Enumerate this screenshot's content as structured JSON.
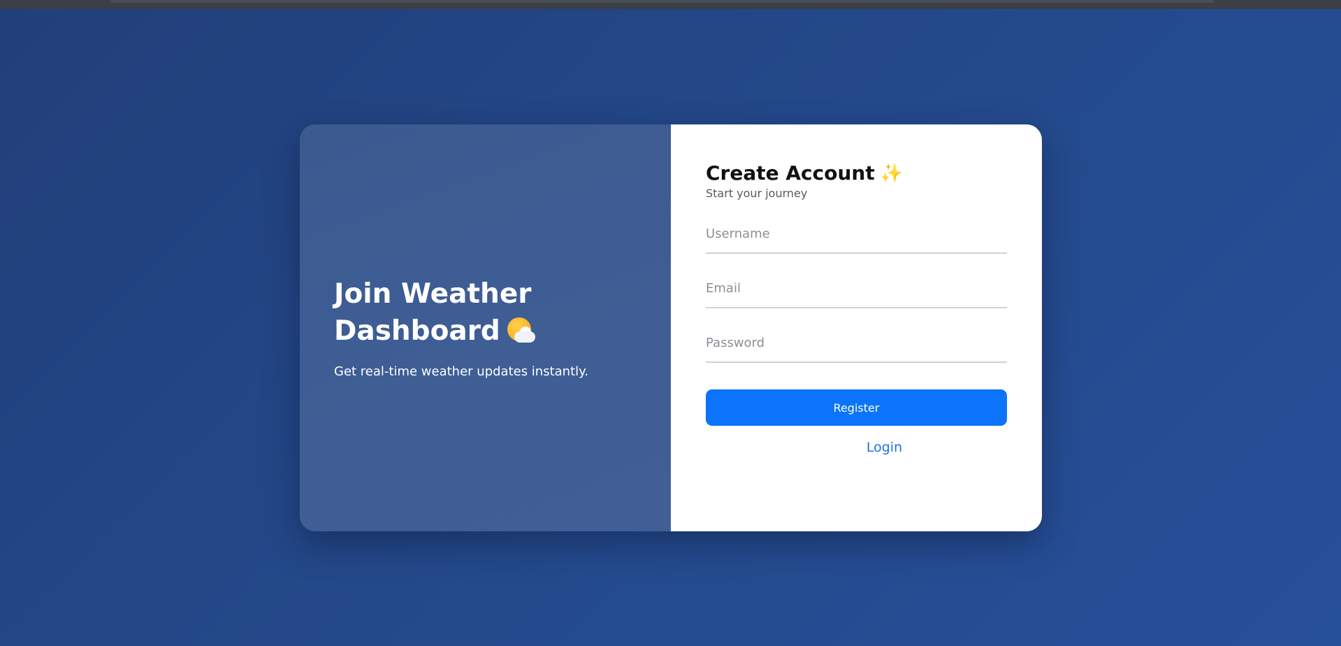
{
  "left_panel": {
    "title": "Join Weather Dashboard",
    "title_icon": "cloud-sun-icon",
    "subtitle": "Get real-time weather updates instantly."
  },
  "form": {
    "title": "Create Account",
    "title_icon": "sparkles-icon",
    "subtitle": "Start your journey",
    "username_placeholder": "Username",
    "email_placeholder": "Email",
    "password_placeholder": "Password",
    "register_label": "Register",
    "login_label": "Login"
  },
  "colors": {
    "background": "#244a8c",
    "left_panel": "#3d5d93",
    "primary_button": "#0b74fb",
    "link": "#1a73e8"
  }
}
